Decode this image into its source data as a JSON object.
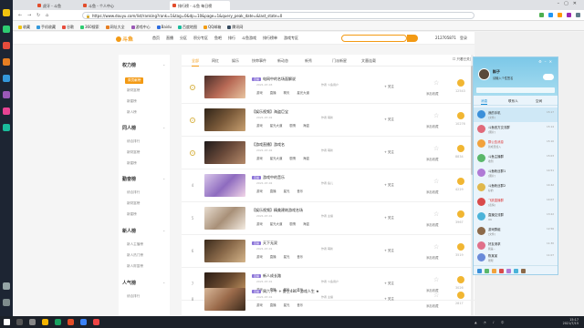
{
  "browser": {
    "tabs": [
      {
        "label": "虎牙 - 斗鱼"
      },
      {
        "label": "斗鱼 - 个人中心"
      },
      {
        "label": "排行榜 - 斗鱼 每日榜"
      }
    ],
    "active_tab_index": 2,
    "url": "https://www.douyu.com/list/ranking?rank=1&tag=0&dp=10&page=1&query_peak_date=&last_state=0",
    "bookmarks": [
      "收藏",
      "手机收藏",
      "谷歌",
      "360搜索",
      "网址大全",
      "游戏中心",
      "Baidu",
      "百度地图",
      "QQ邮箱",
      "腾讯网"
    ]
  },
  "site": {
    "logo": "斗鱼",
    "nav": [
      "首页",
      "直播",
      "分区",
      "积分专区",
      "鱼吧",
      "排行",
      "斗鱼游戏",
      "排行榜单",
      "游戏专区"
    ],
    "search_placeholder": "",
    "room_no": "212705871",
    "header_extra": "登录"
  },
  "sidebar": {
    "groups": [
      {
        "title": "权力榜",
        "items": [
          "周贡献榜",
          "新财富榜",
          "新星榜",
          "新人榜"
        ]
      },
      {
        "title": "同人榜",
        "items": [
          "综合排行",
          "新财富榜",
          "新星榜"
        ]
      },
      {
        "title": "勤奋榜",
        "items": [
          "综合排行",
          "新财富榜",
          "新星榜"
        ]
      },
      {
        "title": "新人榜",
        "items": [
          "新人主播榜",
          "新人热门榜",
          "新人财富榜"
        ]
      },
      {
        "title": "人气榜",
        "items": [
          "综合排行"
        ]
      }
    ]
  },
  "ranking": {
    "tabs": [
      "全部",
      "网红",
      "娱乐",
      "快审事件",
      "新动态",
      "新秀",
      "门派新星",
      "文墨连载"
    ],
    "only_follow_label": "只看已关注",
    "rows": [
      {
        "rank": "1",
        "title": "电网中的名场面解说",
        "badge": "直播",
        "meta": "2021-07-03",
        "author": "作者 斗鱼用户",
        "tags": [
          "游戏",
          "直播",
          "聊天",
          "星光大道"
        ],
        "follow": "+ 关注",
        "heat": "12543",
        "add": "添加收藏"
      },
      {
        "rank": "2",
        "title": "【娱乐视频】海盗巨宝",
        "badge": "",
        "meta": "2021-07-02",
        "author": "作者 萌新",
        "tags": [
          "游戏",
          "星光大道",
          "剧情",
          "海盗"
        ],
        "follow": "+ 关注",
        "heat": "10276",
        "add": "添加收藏"
      },
      {
        "rank": "3",
        "title": "【游戏直播】游戏名",
        "badge": "",
        "meta": "2021-07-02",
        "author": "作者 萌新",
        "tags": [
          "游戏",
          "星光大道",
          "剧情",
          "海盗"
        ],
        "follow": "+ 关注",
        "heat": "8834",
        "add": "添加收藏"
      },
      {
        "rank": "4",
        "title": "游戏中的音乐",
        "badge": "直播",
        "meta": "2021-07-02",
        "author": "作者 鱼儿",
        "tags": [
          "游戏",
          "直播",
          "星光",
          "音乐"
        ],
        "follow": "+ 关注",
        "heat": "4229",
        "add": "添加收藏"
      },
      {
        "rank": "5",
        "title": "【娱乐视频】精美建筑游戏名场",
        "badge": "",
        "meta": "2021-07-01",
        "author": "作者 主播",
        "tags": [
          "游戏",
          "星光大道",
          "剧情",
          "海盗"
        ],
        "follow": "+ 关注",
        "heat": "3967",
        "add": "添加收藏"
      },
      {
        "rank": "6",
        "title": "天下无双",
        "badge": "直播",
        "meta": "2021-07-01",
        "author": "作者 萌新",
        "tags": [
          "游戏",
          "直播",
          "星光",
          "音乐"
        ],
        "follow": "+ 关注",
        "heat": "3519",
        "add": "添加收藏"
      },
      {
        "rank": "7",
        "title": "新人成长路",
        "badge": "直播",
        "meta": "2021-07-01",
        "author": "作者 斗鱼用户",
        "tags": [
          "游戏",
          "直播",
          "星光",
          "音乐"
        ],
        "follow": "+ 关注",
        "heat": "3026",
        "add": "添加收藏"
      },
      {
        "rank": "8",
        "title": "周六下午 + 野生480~游戏人生 ★",
        "badge": "直播",
        "meta": "2021-07-01",
        "author": "作者 主播",
        "tags": [
          "游戏",
          "直播",
          "星光",
          "音乐"
        ],
        "follow": "+ 关注",
        "heat": "2817",
        "add": "添加收藏"
      }
    ]
  },
  "qq": {
    "name": "斟子",
    "signature": "请输入个性签名",
    "tabs": [
      "消息",
      "联系人",
      "空间"
    ],
    "messages": [
      {
        "name": "我的手机",
        "preview": "[文件]",
        "time": "15:17",
        "right": ""
      },
      {
        "name": "斗鱼官方交流群",
        "preview": "[图片]",
        "time": "15:14",
        "right": ""
      },
      {
        "name": "群公告消息",
        "preview": "新成员加入",
        "time": "15:10",
        "right": ""
      },
      {
        "name": "斗鱼主播群",
        "preview": "收到",
        "time": "15:03",
        "right": ""
      },
      {
        "name": "斗鱼粉丝群1",
        "preview": "[图片]",
        "time": "14:51",
        "right": ""
      },
      {
        "name": "斗鱼粉丝群2",
        "preview": "好的",
        "time": "14:42",
        "right": ""
      },
      {
        "name": "飞跃直播群",
        "preview": "[表情]",
        "time": "14:07",
        "right": ""
      },
      {
        "name": "直播交流群",
        "preview": "OK",
        "time": "13:22",
        "right": ""
      },
      {
        "name": "游戏群组",
        "preview": "[文件]",
        "time": "12:56",
        "right": ""
      },
      {
        "name": "好友请求",
        "preview": "我是...",
        "time": "11:30",
        "right": ""
      },
      {
        "name": "陈某某",
        "preview": "嗯嗯",
        "time": "11:07",
        "right": ""
      }
    ]
  },
  "taskbar": {
    "clock_time": "15:17",
    "clock_date": "2021/7/15"
  }
}
